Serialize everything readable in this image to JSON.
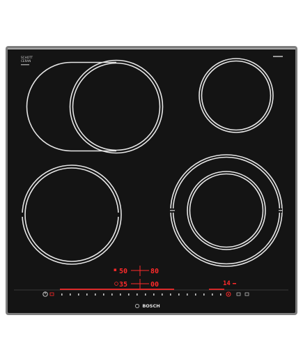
{
  "brand": {
    "ceramic_logo_line1": "SCHOTT",
    "ceramic_logo_line2": "CERAN",
    "logo": "BOSCH"
  },
  "colors": {
    "glass": "#141414",
    "frame": "#8c8c8c",
    "ring": "#e6e6e6",
    "display_red": "#ff2a2a"
  },
  "display": {
    "front_left_value": "50",
    "rear_left_value": "80",
    "front_left_timer": "35",
    "rear_left_timer": "00",
    "timer_readout": "14"
  },
  "controls": {
    "power_icon": "power-icon",
    "slider": "power-level-slider",
    "favorite_icon": "target-icon"
  }
}
